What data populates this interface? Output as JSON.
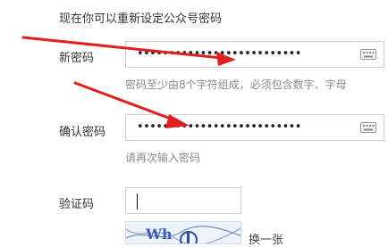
{
  "intro": "现在你可以重新设定公众号密码",
  "new_password": {
    "label": "新密码",
    "value": "••••••••••••••••••••••••••",
    "hint": "密码至少由8个字符组成，必须包含数字、字母"
  },
  "confirm_password": {
    "label": "确认密码",
    "value": "••••••••••••••••••••••••••",
    "hint": "请再次输入密码"
  },
  "captcha": {
    "label": "验证码",
    "value": "",
    "image_text": "Wh",
    "change_text": "换一张"
  },
  "colors": {
    "arrow": "#e02020",
    "border": "#cfcfcf",
    "hint": "#8a8a8a"
  },
  "icons": [
    "keyboard-icon",
    "arrow-annotation"
  ]
}
